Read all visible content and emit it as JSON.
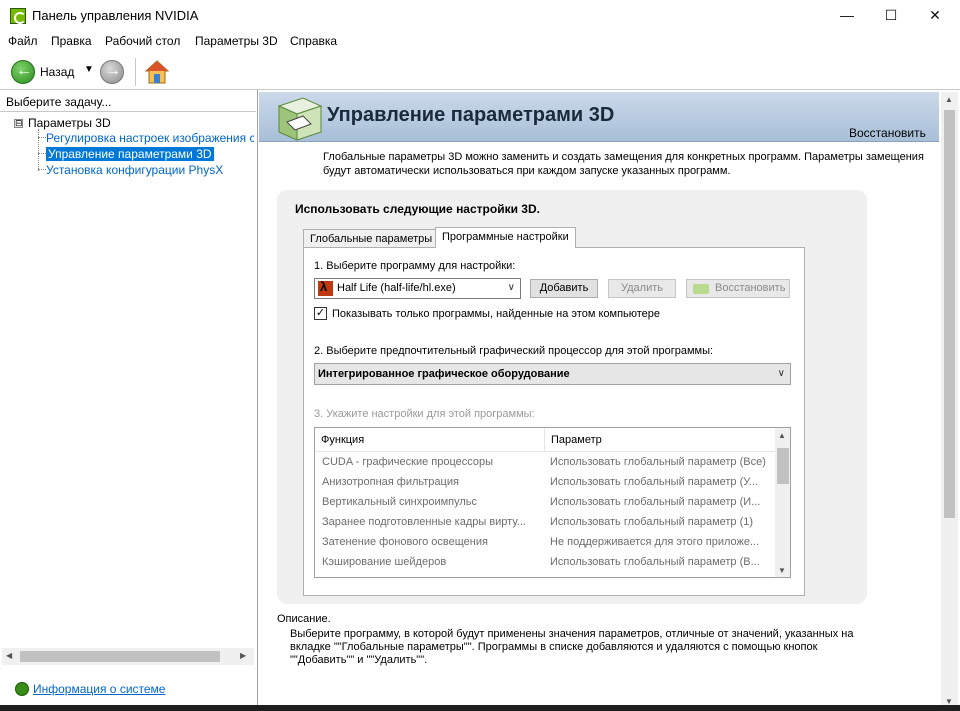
{
  "window": {
    "title": "Панель управления NVIDIA",
    "controls": {
      "minimize": "—",
      "maximize": "☐",
      "close": "✕"
    }
  },
  "menu": [
    "Файл",
    "Правка",
    "Рабочий стол",
    "Параметры 3D",
    "Справка"
  ],
  "toolbar": {
    "back_label": "Назад",
    "back_dropdown": "▼",
    "icons": [
      "back-arrow-icon",
      "forward-arrow-icon",
      "home-icon"
    ]
  },
  "left": {
    "header": "Выберите задачу...",
    "tree": {
      "expander": "⊟",
      "root": "Параметры 3D",
      "children": [
        "Регулировка настроек изображения с пр",
        "Управление параметрами 3D",
        "Установка конфигурации PhysX"
      ],
      "selected_index": 1
    },
    "sysinfo_link": "Информация о системе"
  },
  "main": {
    "title": "Управление параметрами 3D",
    "restore_link": "Восстановить",
    "description": "Глобальные параметры 3D можно заменить и создать замещения для конкретных программ. Параметры замещения будут автоматически использоваться при каждом запуске указанных программ.",
    "use_settings_label": "Использовать следующие настройки 3D.",
    "tabs": [
      "Глобальные параметры",
      "Программные настройки"
    ],
    "active_tab": 1,
    "step1": "1. Выберите программу для настройки:",
    "program_selected": "Half Life (half-life/hl.exe)",
    "add_button": "Добавить",
    "delete_button": "Удалить",
    "restore_button": "Восстановить",
    "show_only_checked": true,
    "checkbox_mark": "✓",
    "show_only_label": "Показывать только программы, найденные на этом компьютере",
    "step2": "2. Выберите предпочтительный графический процессор для этой программы:",
    "gpu_selected": "Интегрированное графическое оборудование",
    "step3": "3. Укажите настройки для этой программы:",
    "table": {
      "headers": [
        "Функция",
        "Параметр"
      ],
      "rows": [
        [
          "CUDA - графические процессоры",
          "Использовать глобальный параметр (Все)"
        ],
        [
          "Анизотропная фильтрация",
          "Использовать глобальный параметр (У..."
        ],
        [
          "Вертикальный синхроимпульс",
          "Использовать глобальный параметр (И..."
        ],
        [
          "Заранее подготовленные кадры вирту...",
          "Использовать глобальный параметр (1)"
        ],
        [
          "Затенение фонового освещения",
          "Не поддерживается для этого приложе..."
        ],
        [
          "Кэширование шейдеров",
          "Использовать глобальный параметр (В..."
        ]
      ],
      "scroll_up": "▲",
      "scroll_down": "▼"
    },
    "footer_label": "Описание.",
    "footer_text": "Выберите программу, в которой будут применены значения параметров, отличные от значений, указанных на вкладке \"\"Глобальные параметры\"\". Программы в списке добавляются и удаляются с помощью кнопок \"\"Добавить\"\" и \"\"Удалить\"\"."
  },
  "colors": {
    "banner_gradient_top": "#cbd9ea",
    "banner_gradient_bottom": "#a8bfd8",
    "nvidia_green": "#76b900",
    "link_blue": "#0066cc",
    "selection_blue": "#0078d7"
  }
}
